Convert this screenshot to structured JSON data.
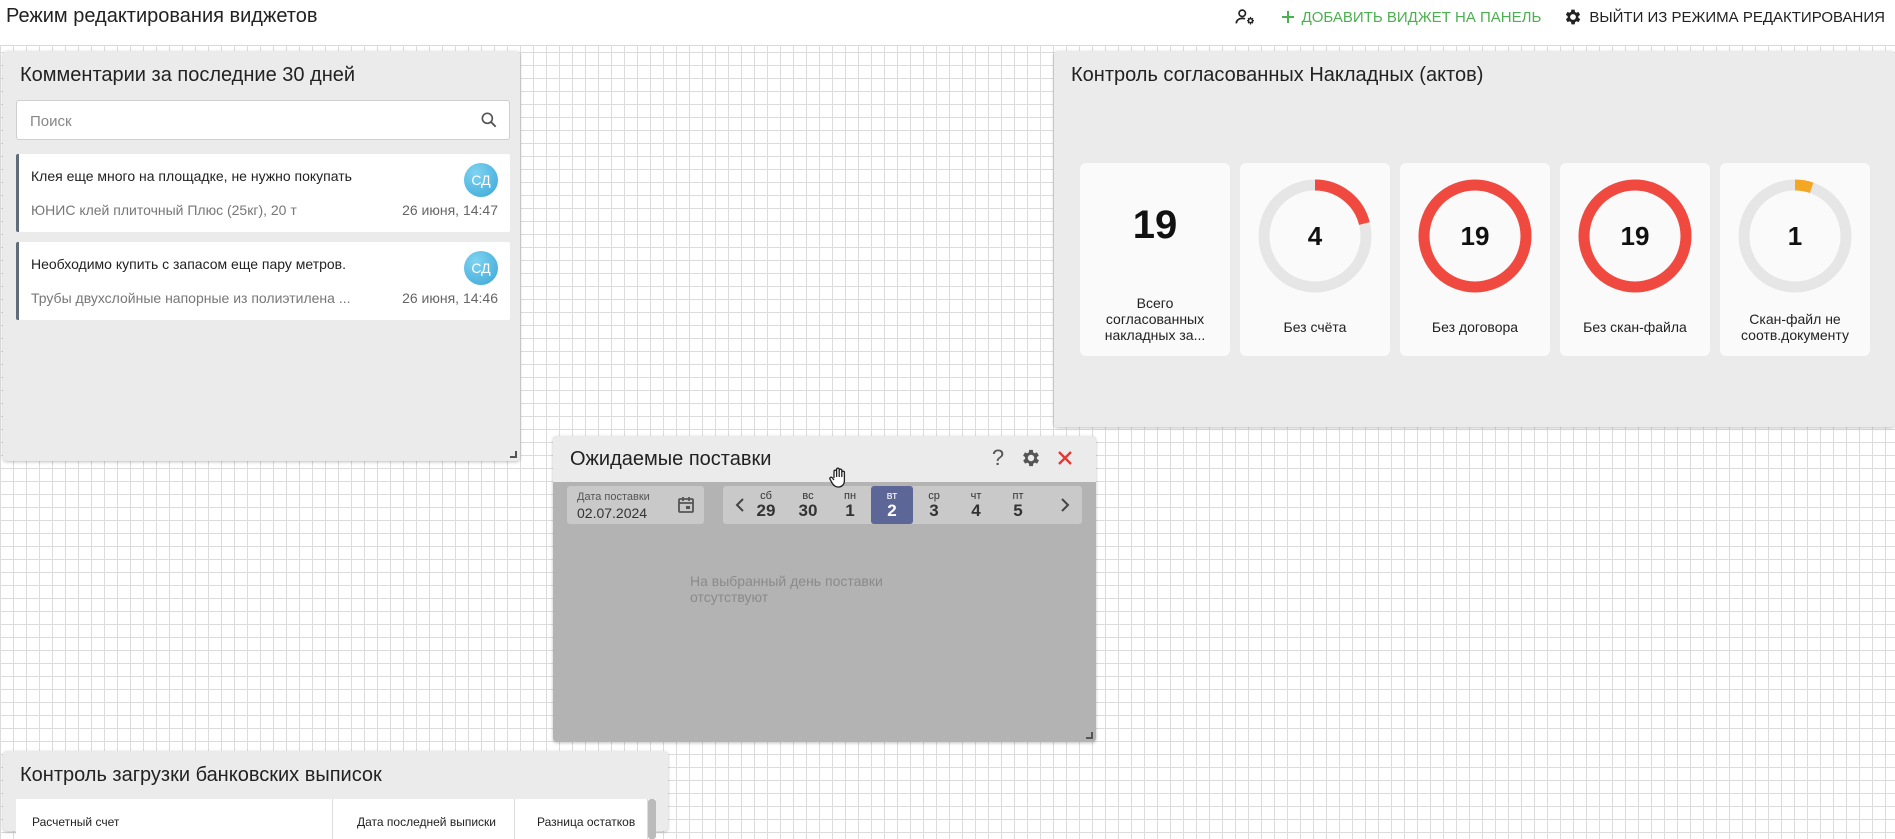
{
  "header": {
    "title": "Режим редактирования виджетов",
    "add_widget_label": "ДОБАВИТЬ ВИДЖЕТ НА ПАНЕЛЬ",
    "exit_label": "ВЫЙТИ ИЗ РЕЖИМА РЕДАКТИРОВАНИЯ",
    "accent_color": "#4caf50"
  },
  "comments": {
    "title": "Комментарии за последние 30 дней",
    "search_placeholder": "Поиск",
    "items": [
      {
        "text": "Клея еще много на площадке, не нужно покупать",
        "subtitle": "ЮНИС клей плиточный Плюс (25кг), 20 т",
        "date": "26 июня, 14:47",
        "avatar": "СД"
      },
      {
        "text": "Необходимо купить с запасом еще пару метров.",
        "subtitle": "Трубы двухслойные напорные из полиэтилена ...",
        "date": "26 июня, 14:46",
        "avatar": "СД"
      }
    ]
  },
  "invoices": {
    "title": "Контроль согласованных Накладных (актов)",
    "kpis": [
      {
        "value": "19",
        "label": "Всего согласованных накладных за...",
        "type": "number"
      },
      {
        "value": "4",
        "label": "Без счёта",
        "type": "donut",
        "fraction": 0.21,
        "color": "#f04a40"
      },
      {
        "value": "19",
        "label": "Без договора",
        "type": "donut",
        "fraction": 1.0,
        "color": "#f04a40"
      },
      {
        "value": "19",
        "label": "Без скан-файла",
        "type": "donut",
        "fraction": 1.0,
        "color": "#f04a40"
      },
      {
        "value": "1",
        "label": "Скан-файл не соотв.документу",
        "type": "donut",
        "fraction": 0.053,
        "color": "#f5a623"
      }
    ]
  },
  "deliveries": {
    "title": "Ожидаемые поставки",
    "date_label": "Дата поставки",
    "date_value": "02.07.2024",
    "days": [
      {
        "wd": "сб",
        "num": "29"
      },
      {
        "wd": "вс",
        "num": "30"
      },
      {
        "wd": "пн",
        "num": "1"
      },
      {
        "wd": "вт",
        "num": "2",
        "selected": true
      },
      {
        "wd": "ср",
        "num": "3"
      },
      {
        "wd": "чт",
        "num": "4"
      },
      {
        "wd": "пт",
        "num": "5"
      }
    ],
    "empty_message": "На выбранный день поставки отсутствуют",
    "selected_color": "#5c6697",
    "close_color": "#e53935"
  },
  "bank": {
    "title": "Контроль загрузки банковских выписок",
    "columns": [
      "Расчетный счет",
      "Дата последней выписки",
      "Разница остатков"
    ]
  }
}
